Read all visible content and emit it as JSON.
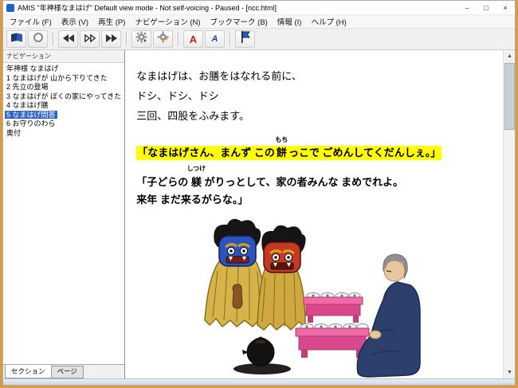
{
  "window": {
    "title": "AMIS \"年神様なまはげ\" Default view mode - Not self-voicing - Paused - [ncc.html]"
  },
  "icons": {
    "minimize": "–",
    "maximize": "□",
    "close": "×",
    "scroll_up": "▲",
    "scroll_down": "▼",
    "font_larger": "A",
    "font_smaller": "A"
  },
  "menubar": {
    "items": [
      "ファイル (F)",
      "表示 (V)",
      "再生 (P)",
      "ナビゲーション (N)",
      "ブックマーク (B)",
      "情報 (I)",
      "ヘルプ (H)"
    ]
  },
  "sidebar": {
    "header": "ナビゲーション",
    "items": [
      "年神様 なまはげ",
      "1 なまはげが 山から下りてきた",
      "2 先立の登場",
      "3 なまはげが ぼくの家にやってきた",
      "4 なまはげ膳",
      "5 なまはげ問答",
      "6 お守りのわら",
      "奥付"
    ],
    "selected_item": "5 なまはげ問答",
    "tabs": [
      "セクション",
      "ページ"
    ]
  },
  "content": {
    "para1": "なまはげは、お膳をはなれる前に、",
    "para2": "ドシ、ドシ、ドシ",
    "para3": "三回、四股をふみます。",
    "quote1": {
      "pre": "「なまはげさん、まんず この",
      "ruby_base": "餅",
      "ruby_text": "もち",
      "post": "っこで ごめんしてくだんしぇ。」",
      "highlight_color": "#ffff00"
    },
    "quote2": {
      "pre": "「子どらの ",
      "ruby_base": "躾",
      "ruby_text": "しつけ",
      "post": " がりっとして、家の者みんな まめでれよ。",
      "line2": "来年 まだ来るがらな。」"
    }
  },
  "colors": {
    "selection_blue": "#2e62c9",
    "highlight_yellow": "#ffff00",
    "desktop_edge_orange": "#e09a35"
  }
}
